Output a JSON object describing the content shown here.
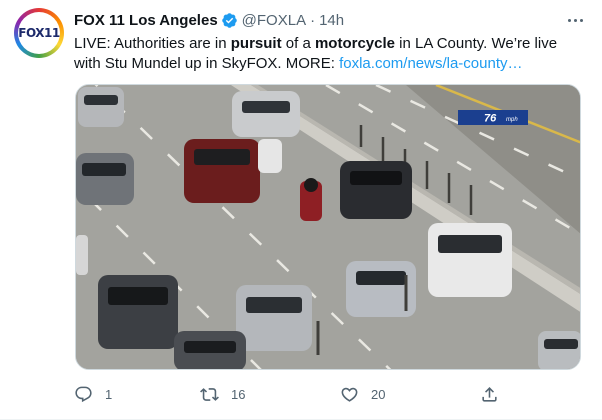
{
  "account": {
    "avatar_text": "FOX11",
    "display_name": "FOX 11 Los Angeles",
    "handle": "@FOXLA",
    "separator": "·",
    "timestamp": "14h"
  },
  "tweet": {
    "text_parts": {
      "p1": "LIVE: Authorities are in ",
      "b1": "pursuit",
      "p2": " of a ",
      "b2": "motorcycle",
      "p3": " in LA County. We’re live with Stu Mundel up in SkyFOX. MORE: "
    },
    "link_text": "foxla.com/news/la-county…"
  },
  "media": {
    "speed_value": "76",
    "speed_unit": "mph"
  },
  "actions": {
    "reply_count": "1",
    "retweet_count": "16",
    "like_count": "20"
  },
  "colors": {
    "accent": "#1d9bf0",
    "secondary_text": "#536471",
    "speed_badge": "#1b3f8f"
  }
}
